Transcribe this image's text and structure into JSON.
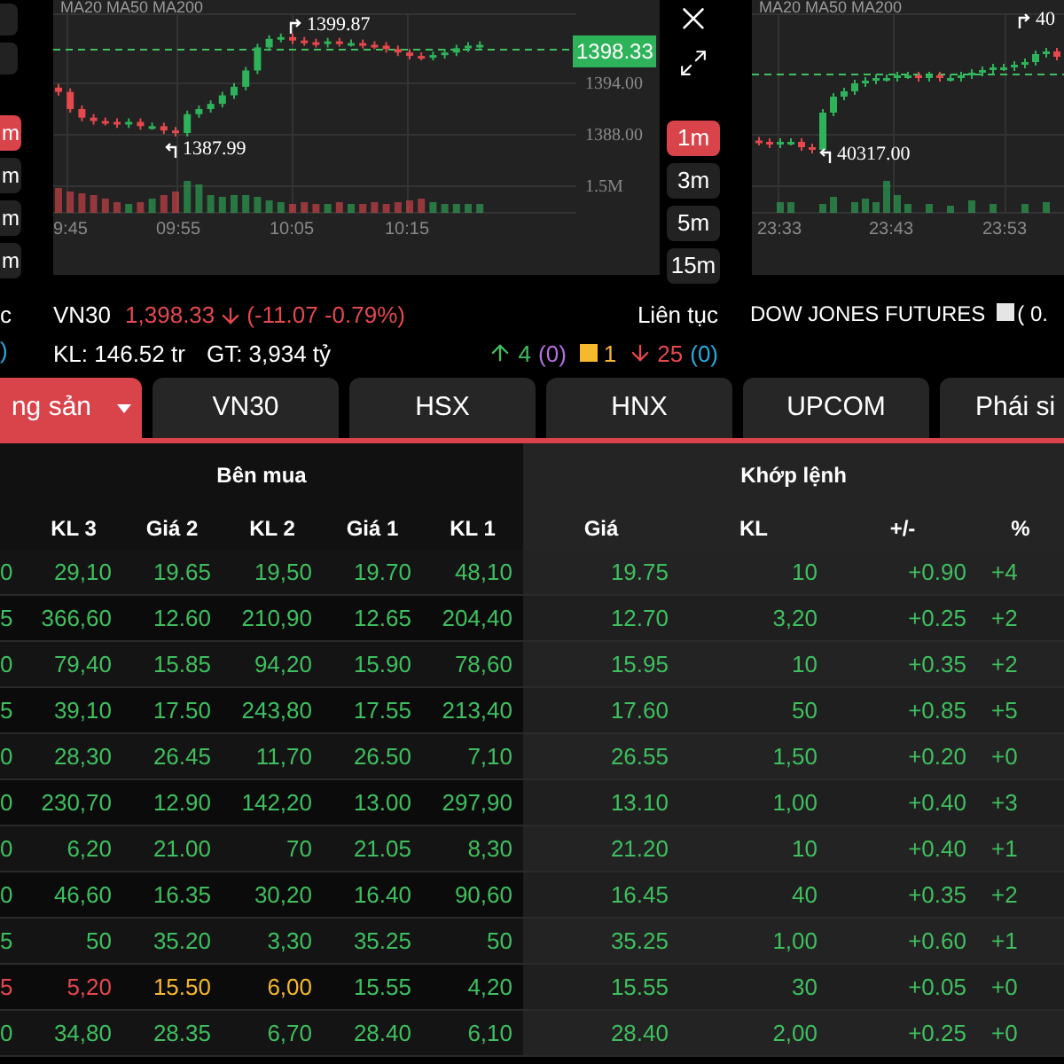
{
  "left_stub": {
    "texts": [
      "c",
      ")"
    ],
    "timeframes": [
      {
        "label": "m",
        "selected": true
      },
      {
        "label": "m",
        "selected": false
      },
      {
        "label": "m",
        "selected": false
      },
      {
        "label": "m",
        "selected": false
      }
    ]
  },
  "chart_1": {
    "indicators": "MA20 MA50 MA200",
    "high": "1399.87",
    "low": "1387.99",
    "last_price": "1398.33",
    "axis": [
      "1394.00",
      "1388.00",
      "1.5M"
    ],
    "times": [
      "9:45",
      "09:55",
      "10:05",
      "10:15"
    ]
  },
  "chart_controls": {
    "timeframes": [
      {
        "label": "1m",
        "selected": true
      },
      {
        "label": "3m",
        "selected": false
      },
      {
        "label": "5m",
        "selected": false
      },
      {
        "label": "15m",
        "selected": false
      }
    ]
  },
  "chart_2": {
    "indicators": "MA20 MA50 MA200",
    "high": "40",
    "low": "40317.00",
    "times": [
      "23:33",
      "23:43",
      "23:53"
    ]
  },
  "index_1": {
    "name": "VN30",
    "value": "1,398.33",
    "falling": true,
    "change": "(-11.07 -0.79%)",
    "session": "Liên tục",
    "volume": "KL: 146.52 tr",
    "turnover": "GT: 3,934 tỷ",
    "advances": "4",
    "ceiling": "(0)",
    "unchanged": "1",
    "declines": "25",
    "floor": "(0)"
  },
  "index_2": {
    "name": "DOW JONES FUTURES",
    "change": "( 0."
  },
  "tabs": [
    {
      "label": "ng sản",
      "selected": true,
      "dropdown": true
    },
    {
      "label": "VN30",
      "selected": false
    },
    {
      "label": "HSX",
      "selected": false
    },
    {
      "label": "HNX",
      "selected": false
    },
    {
      "label": "UPCOM",
      "selected": false
    },
    {
      "label": "Phái si",
      "selected": false
    }
  ],
  "table": {
    "groups": [
      "Bên mua",
      "Khớp lệnh"
    ],
    "columns": [
      "",
      "KL 3",
      "Giá 2",
      "KL 2",
      "Giá 1",
      "KL 1",
      "Giá",
      "KL",
      "+/-",
      "%"
    ],
    "rows": [
      {
        "color": "#3fbf5f",
        "cells": [
          "0",
          "29,10",
          "19.65",
          "19,50",
          "19.70",
          "48,10",
          "19.75",
          "10",
          "+0.90",
          "+4"
        ]
      },
      {
        "color": "#3fbf5f",
        "cells": [
          "5",
          "366,60",
          "12.60",
          "210,90",
          "12.65",
          "204,40",
          "12.70",
          "3,20",
          "+0.25",
          "+2"
        ]
      },
      {
        "color": "#3fbf5f",
        "cells": [
          "0",
          "79,40",
          "15.85",
          "94,20",
          "15.90",
          "78,60",
          "15.95",
          "10",
          "+0.35",
          "+2"
        ]
      },
      {
        "color": "#3fbf5f",
        "cells": [
          "5",
          "39,10",
          "17.50",
          "243,80",
          "17.55",
          "213,40",
          "17.60",
          "50",
          "+0.85",
          "+5"
        ]
      },
      {
        "color": "#3fbf5f",
        "cells": [
          "0",
          "28,30",
          "26.45",
          "11,70",
          "26.50",
          "7,10",
          "26.55",
          "1,50",
          "+0.20",
          "+0"
        ]
      },
      {
        "color": "#3fbf5f",
        "cells": [
          "0",
          "230,70",
          "12.90",
          "142,20",
          "13.00",
          "297,90",
          "13.10",
          "1,00",
          "+0.40",
          "+3"
        ]
      },
      {
        "color": "#3fbf5f",
        "cells": [
          "0",
          "6,20",
          "21.00",
          "70",
          "21.05",
          "8,30",
          "21.20",
          "10",
          "+0.40",
          "+1"
        ]
      },
      {
        "color": "#3fbf5f",
        "cells": [
          "0",
          "46,60",
          "16.35",
          "30,20",
          "16.40",
          "90,60",
          "16.45",
          "40",
          "+0.35",
          "+2"
        ]
      },
      {
        "color": "#3fbf5f",
        "cells": [
          "5",
          "50",
          "35.20",
          "3,30",
          "35.25",
          "50",
          "35.25",
          "1,00",
          "+0.60",
          "+1"
        ]
      },
      {
        "cells": [
          {
            "text": "5",
            "color": "#e5484d"
          },
          {
            "text": "5,20",
            "color": "#e5484d"
          },
          {
            "text": "15.50",
            "color": "#f5b82e"
          },
          {
            "text": "6,00",
            "color": "#f5b82e"
          },
          {
            "text": "15.55",
            "color": "#3fbf5f"
          },
          {
            "text": "4,20",
            "color": "#3fbf5f"
          },
          {
            "text": "15.55",
            "color": "#3fbf5f"
          },
          {
            "text": "30",
            "color": "#3fbf5f"
          },
          {
            "text": "+0.05",
            "color": "#3fbf5f"
          },
          {
            "text": "+0",
            "color": "#3fbf5f"
          }
        ]
      },
      {
        "color": "#3fbf5f",
        "cells": [
          "0",
          "34,80",
          "28.35",
          "6,70",
          "28.40",
          "6,10",
          "28.40",
          "2,00",
          "+0.25",
          "+0"
        ]
      }
    ]
  }
}
